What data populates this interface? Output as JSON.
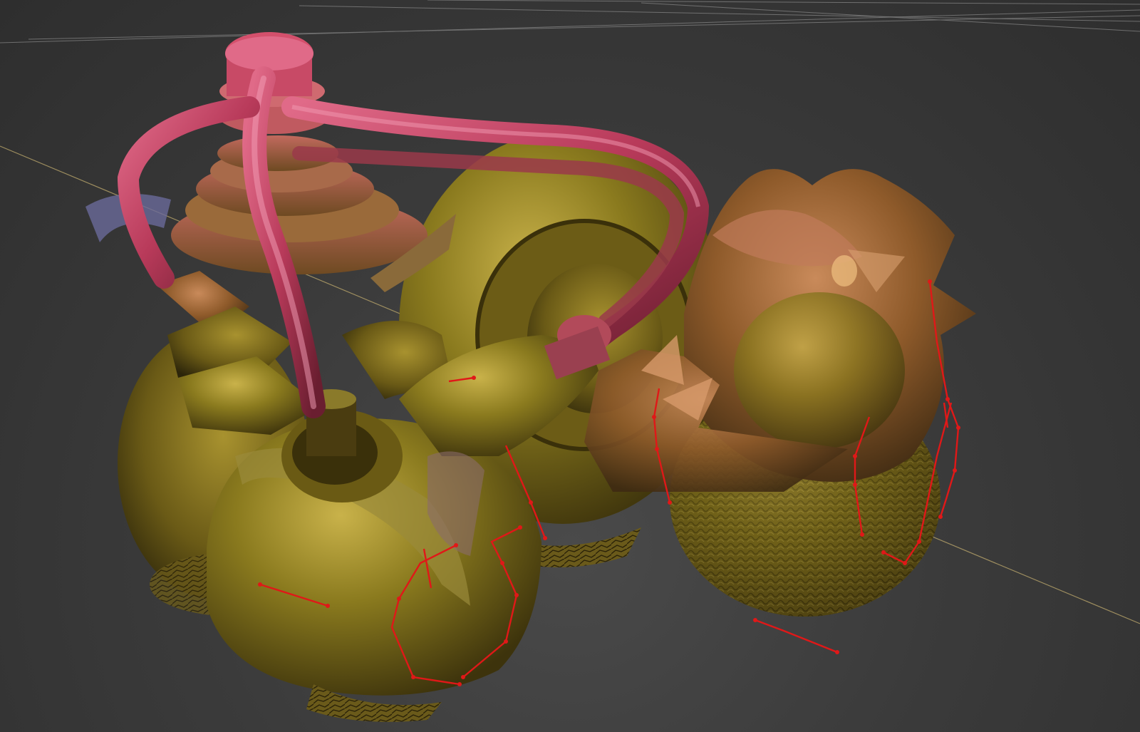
{
  "viewport": {
    "kind": "3d-sculpt-viewport",
    "background_color": "#3a3a3a",
    "grid_color": "#8a8a8a",
    "axis_color": "#b8a46a",
    "model": {
      "description_icon": "sculpted-vehicle-model",
      "palette": {
        "body_olive": "#8a7a1e",
        "body_dark": "#4a3f10",
        "pipe_pink": "#d14a6a",
        "pipe_dark": "#7a2036",
        "highlight": "#e8d48a",
        "rim_blue": "#5a6a8a"
      }
    },
    "guide_curves": {
      "color": "#e01818",
      "count": 12
    }
  }
}
